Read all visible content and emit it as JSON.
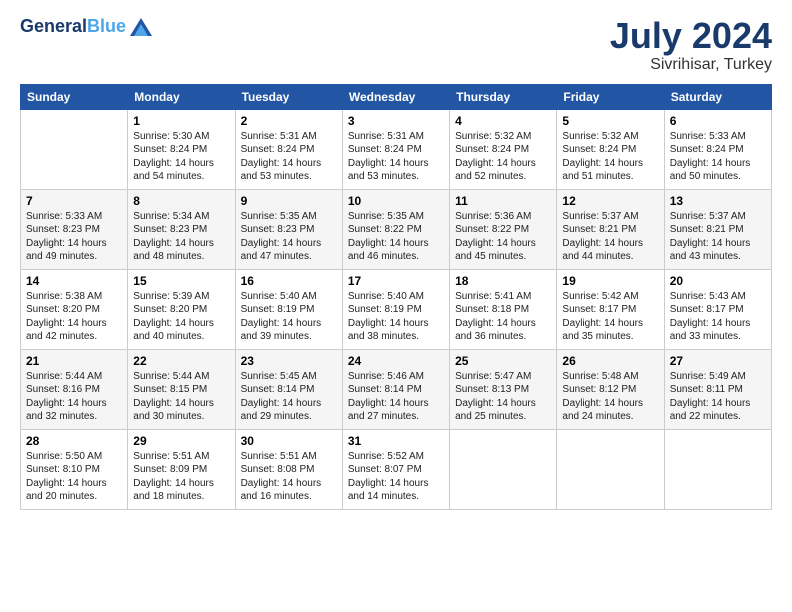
{
  "header": {
    "logo_line1": "General",
    "logo_line2": "Blue",
    "title": "July 2024",
    "subtitle": "Sivrihisar, Turkey"
  },
  "columns": [
    "Sunday",
    "Monday",
    "Tuesday",
    "Wednesday",
    "Thursday",
    "Friday",
    "Saturday"
  ],
  "weeks": [
    [
      {
        "day": "",
        "content": ""
      },
      {
        "day": "1",
        "content": "Sunrise: 5:30 AM\nSunset: 8:24 PM\nDaylight: 14 hours\nand 54 minutes."
      },
      {
        "day": "2",
        "content": "Sunrise: 5:31 AM\nSunset: 8:24 PM\nDaylight: 14 hours\nand 53 minutes."
      },
      {
        "day": "3",
        "content": "Sunrise: 5:31 AM\nSunset: 8:24 PM\nDaylight: 14 hours\nand 53 minutes."
      },
      {
        "day": "4",
        "content": "Sunrise: 5:32 AM\nSunset: 8:24 PM\nDaylight: 14 hours\nand 52 minutes."
      },
      {
        "day": "5",
        "content": "Sunrise: 5:32 AM\nSunset: 8:24 PM\nDaylight: 14 hours\nand 51 minutes."
      },
      {
        "day": "6",
        "content": "Sunrise: 5:33 AM\nSunset: 8:24 PM\nDaylight: 14 hours\nand 50 minutes."
      }
    ],
    [
      {
        "day": "7",
        "content": "Sunrise: 5:33 AM\nSunset: 8:23 PM\nDaylight: 14 hours\nand 49 minutes."
      },
      {
        "day": "8",
        "content": "Sunrise: 5:34 AM\nSunset: 8:23 PM\nDaylight: 14 hours\nand 48 minutes."
      },
      {
        "day": "9",
        "content": "Sunrise: 5:35 AM\nSunset: 8:23 PM\nDaylight: 14 hours\nand 47 minutes."
      },
      {
        "day": "10",
        "content": "Sunrise: 5:35 AM\nSunset: 8:22 PM\nDaylight: 14 hours\nand 46 minutes."
      },
      {
        "day": "11",
        "content": "Sunrise: 5:36 AM\nSunset: 8:22 PM\nDaylight: 14 hours\nand 45 minutes."
      },
      {
        "day": "12",
        "content": "Sunrise: 5:37 AM\nSunset: 8:21 PM\nDaylight: 14 hours\nand 44 minutes."
      },
      {
        "day": "13",
        "content": "Sunrise: 5:37 AM\nSunset: 8:21 PM\nDaylight: 14 hours\nand 43 minutes."
      }
    ],
    [
      {
        "day": "14",
        "content": "Sunrise: 5:38 AM\nSunset: 8:20 PM\nDaylight: 14 hours\nand 42 minutes."
      },
      {
        "day": "15",
        "content": "Sunrise: 5:39 AM\nSunset: 8:20 PM\nDaylight: 14 hours\nand 40 minutes."
      },
      {
        "day": "16",
        "content": "Sunrise: 5:40 AM\nSunset: 8:19 PM\nDaylight: 14 hours\nand 39 minutes."
      },
      {
        "day": "17",
        "content": "Sunrise: 5:40 AM\nSunset: 8:19 PM\nDaylight: 14 hours\nand 38 minutes."
      },
      {
        "day": "18",
        "content": "Sunrise: 5:41 AM\nSunset: 8:18 PM\nDaylight: 14 hours\nand 36 minutes."
      },
      {
        "day": "19",
        "content": "Sunrise: 5:42 AM\nSunset: 8:17 PM\nDaylight: 14 hours\nand 35 minutes."
      },
      {
        "day": "20",
        "content": "Sunrise: 5:43 AM\nSunset: 8:17 PM\nDaylight: 14 hours\nand 33 minutes."
      }
    ],
    [
      {
        "day": "21",
        "content": "Sunrise: 5:44 AM\nSunset: 8:16 PM\nDaylight: 14 hours\nand 32 minutes."
      },
      {
        "day": "22",
        "content": "Sunrise: 5:44 AM\nSunset: 8:15 PM\nDaylight: 14 hours\nand 30 minutes."
      },
      {
        "day": "23",
        "content": "Sunrise: 5:45 AM\nSunset: 8:14 PM\nDaylight: 14 hours\nand 29 minutes."
      },
      {
        "day": "24",
        "content": "Sunrise: 5:46 AM\nSunset: 8:14 PM\nDaylight: 14 hours\nand 27 minutes."
      },
      {
        "day": "25",
        "content": "Sunrise: 5:47 AM\nSunset: 8:13 PM\nDaylight: 14 hours\nand 25 minutes."
      },
      {
        "day": "26",
        "content": "Sunrise: 5:48 AM\nSunset: 8:12 PM\nDaylight: 14 hours\nand 24 minutes."
      },
      {
        "day": "27",
        "content": "Sunrise: 5:49 AM\nSunset: 8:11 PM\nDaylight: 14 hours\nand 22 minutes."
      }
    ],
    [
      {
        "day": "28",
        "content": "Sunrise: 5:50 AM\nSunset: 8:10 PM\nDaylight: 14 hours\nand 20 minutes."
      },
      {
        "day": "29",
        "content": "Sunrise: 5:51 AM\nSunset: 8:09 PM\nDaylight: 14 hours\nand 18 minutes."
      },
      {
        "day": "30",
        "content": "Sunrise: 5:51 AM\nSunset: 8:08 PM\nDaylight: 14 hours\nand 16 minutes."
      },
      {
        "day": "31",
        "content": "Sunrise: 5:52 AM\nSunset: 8:07 PM\nDaylight: 14 hours\nand 14 minutes."
      },
      {
        "day": "",
        "content": ""
      },
      {
        "day": "",
        "content": ""
      },
      {
        "day": "",
        "content": ""
      }
    ]
  ]
}
